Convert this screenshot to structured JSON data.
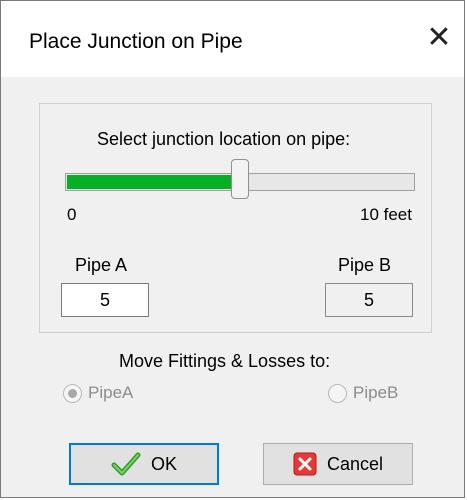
{
  "dialog": {
    "title": "Place Junction on Pipe",
    "close_glyph": "✕"
  },
  "slider": {
    "label": "Select junction location on pipe:",
    "min_label": "0",
    "max_label": "10 feet",
    "value_fraction": 0.5
  },
  "pipes": {
    "a_label": "Pipe A",
    "a_value": "5",
    "b_label": "Pipe B",
    "b_value": "5"
  },
  "move": {
    "label": "Move Fittings & Losses to:",
    "option_a": "PipeA",
    "option_b": "PipeB",
    "selected": "PipeA"
  },
  "buttons": {
    "ok_label": "OK",
    "cancel_label": "Cancel",
    "ok_icon": "checkmark-icon",
    "cancel_icon": "cancel-x-icon"
  },
  "colors": {
    "slider_fill": "#06b025",
    "focus_border": "#0078d7",
    "cancel_red": "#e53935"
  }
}
